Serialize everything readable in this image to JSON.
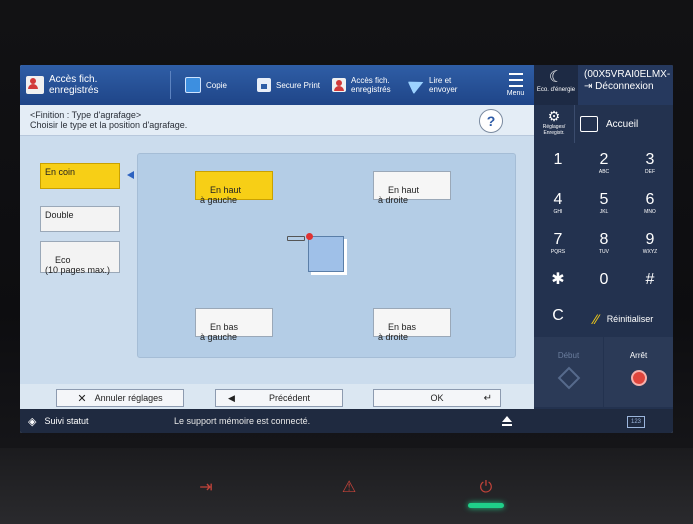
{
  "topbar": {
    "active_item": "Accès fich.\nenregistrés",
    "items": [
      {
        "label": "Copie",
        "icon": "copy-icon"
      },
      {
        "label": "Secure Print",
        "icon": "lock-icon"
      },
      {
        "label": "Accès fich.\nenregistrés",
        "icon": "user-folder-icon"
      },
      {
        "label": "Lire et\nenvoyer",
        "icon": "send-icon"
      }
    ],
    "menu_label": "Menu"
  },
  "rightbar": {
    "eco_label": "Eco. d'énergie",
    "user_id": "(00X5VRAI0ELMX-",
    "logout_label": "Déconnexion"
  },
  "header": {
    "line1": "<Finition : Type d'agrafage>",
    "line2": "Choisir le type et la position d'agrafage.",
    "help": "?"
  },
  "type_options": [
    {
      "label": "En coin",
      "selected": true
    },
    {
      "label": "Double",
      "selected": false
    },
    {
      "label": "Eco\n(10 pages max.)",
      "selected": false
    }
  ],
  "positions": {
    "top_left": "En haut\nà gauche",
    "top_right": "En haut\nà droite",
    "bottom_left": "En bas\nà gauche",
    "bottom_right": "En bas\nà droite",
    "selected": "top_left"
  },
  "footer": {
    "cancel": "Annuler réglages",
    "previous": "Précédent",
    "ok": "OK"
  },
  "status": {
    "suivi": "Suivi statut",
    "message": "Le support mémoire est connecté."
  },
  "keypad": {
    "reglages": "Réglages/\nEnregistr.",
    "accueil": "Accueil",
    "keys": [
      {
        "d": "1",
        "l": ""
      },
      {
        "d": "2",
        "l": "ABC"
      },
      {
        "d": "3",
        "l": "DEF"
      },
      {
        "d": "4",
        "l": "GHI"
      },
      {
        "d": "5",
        "l": "JKL"
      },
      {
        "d": "6",
        "l": "MNO"
      },
      {
        "d": "7",
        "l": "PQRS"
      },
      {
        "d": "8",
        "l": "TUV"
      },
      {
        "d": "9",
        "l": "WXYZ"
      },
      {
        "d": "✱",
        "l": ""
      },
      {
        "d": "0",
        "l": ""
      },
      {
        "d": "#",
        "l": ""
      }
    ],
    "clear": "C",
    "reset": "Réinitialiser",
    "start": "Début",
    "stop": "Arrêt",
    "counter": "123"
  },
  "colors": {
    "accent_blue": "#2f5ea6",
    "selected_yellow": "#f7cf16",
    "stop_red": "#e0453c"
  }
}
